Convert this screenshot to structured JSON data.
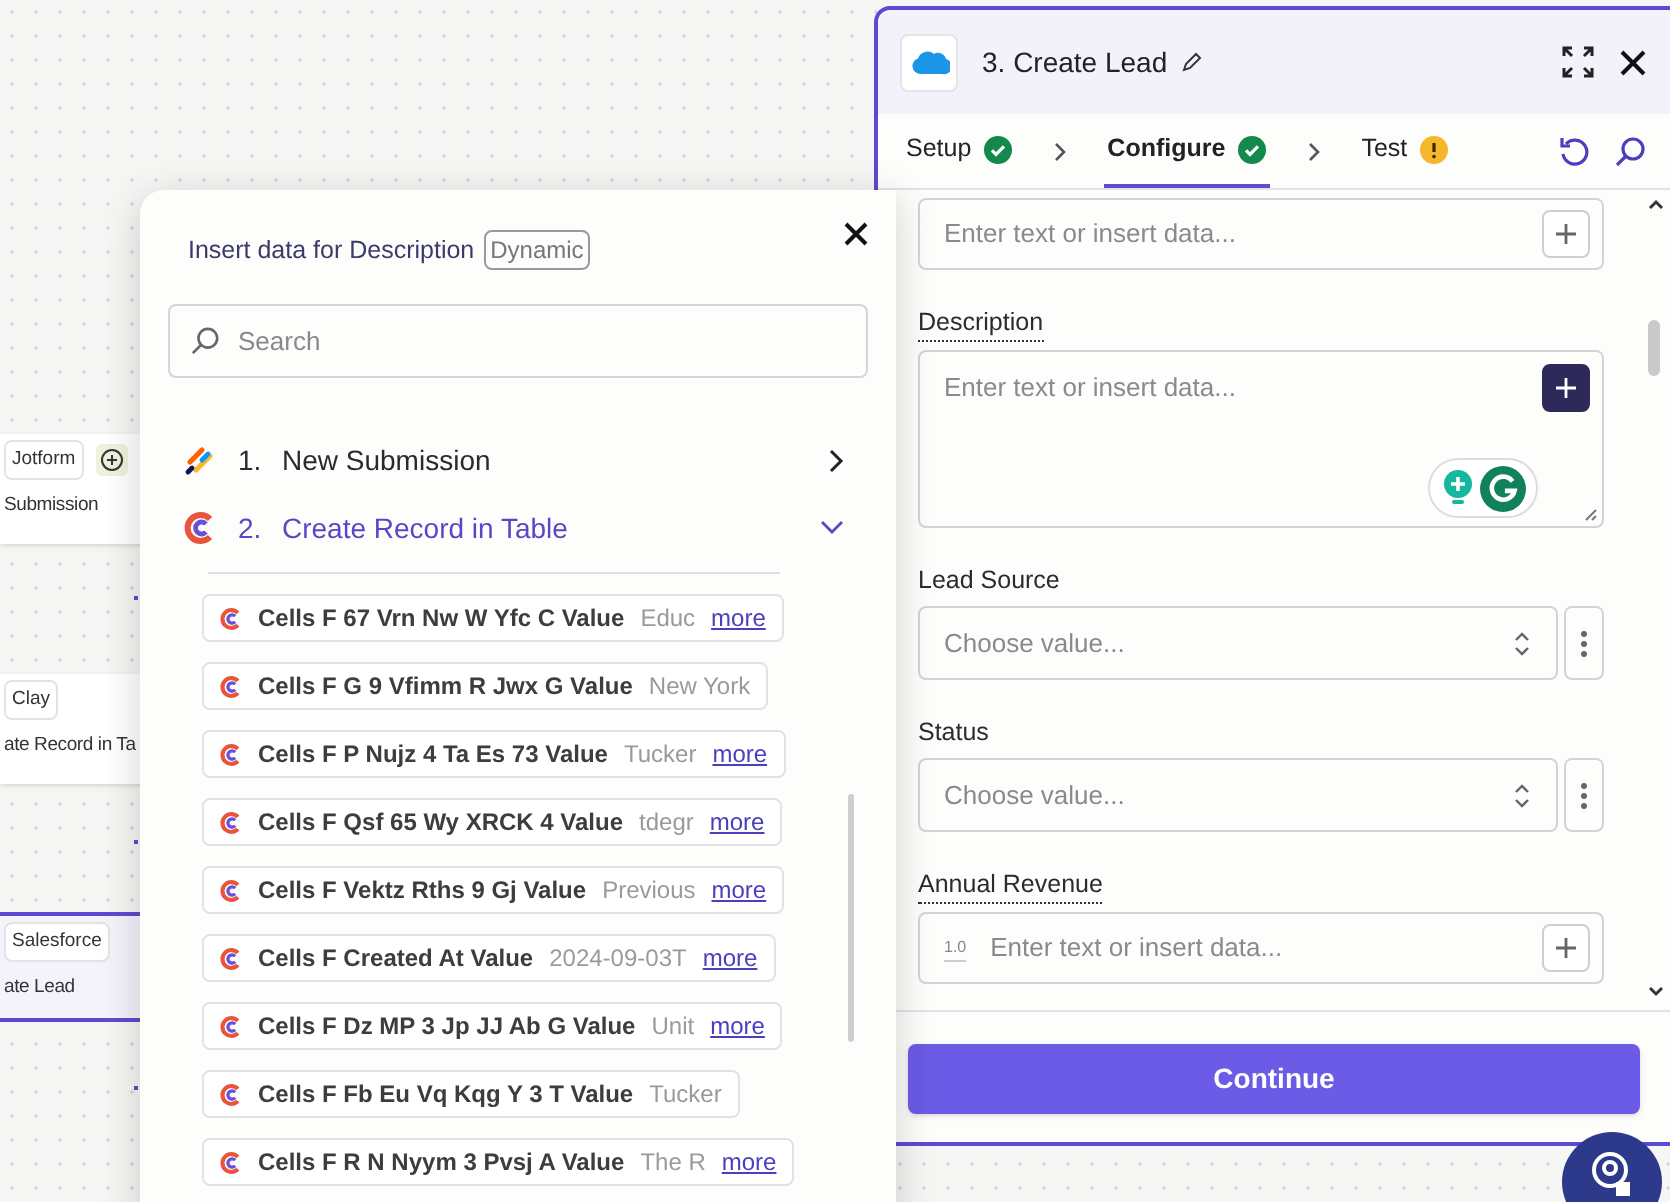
{
  "canvas": {
    "nodes": [
      {
        "app": "Jotform",
        "title": "Submission",
        "selected": false,
        "add_button": true
      },
      {
        "app": "Clay",
        "title": "ate Record in Ta",
        "selected": false,
        "add_button": false
      },
      {
        "app": "Salesforce",
        "title": "ate Lead",
        "selected": true,
        "add_button": false
      }
    ]
  },
  "panel": {
    "title": "3. Create Lead",
    "tabs": [
      {
        "label": "Setup",
        "kind": "done",
        "selected": false
      },
      {
        "label": "Configure",
        "kind": "done",
        "selected": true
      },
      {
        "label": "Test",
        "kind": "warning",
        "selected": false
      }
    ],
    "fields": [
      {
        "kind": "text",
        "placeholder": "Enter text or insert data...",
        "focused": false
      },
      {
        "kind": "textarea",
        "label": "Description",
        "tooltip": true,
        "placeholder": "Enter text or insert data...",
        "focused": true
      },
      {
        "kind": "select",
        "label": "Lead Source",
        "tooltip": false,
        "placeholder": "Choose value...",
        "focused": false
      },
      {
        "kind": "select",
        "label": "Status",
        "tooltip": false,
        "placeholder": "Choose value...",
        "focused": false
      },
      {
        "kind": "number",
        "label": "Annual Revenue",
        "tooltip": true,
        "prefix": "1.0",
        "placeholder": "Enter text or insert data...",
        "focused": false
      }
    ],
    "continue_button": "Continue"
  },
  "popup": {
    "title": "Insert data for Description",
    "badge": "Dynamic",
    "search": {
      "placeholder": "Search"
    },
    "steps": [
      {
        "kind": "jotform",
        "number": "1.",
        "label": "New Submission",
        "expanded": false
      },
      {
        "kind": "clay",
        "number": "2.",
        "label": "Create Record in Table",
        "expanded": true,
        "items": [
          {
            "label": "Cells F 67 Vrn Nw W Yfc C Value",
            "value": "Educ",
            "more": "more"
          },
          {
            "label": "Cells F G 9 Vfimm R Jwx G Value",
            "value": "New York"
          },
          {
            "label": "Cells F P Nujz 4 Ta Es 73 Value",
            "value": "Tucker",
            "more": "more"
          },
          {
            "label": "Cells F Qsf 65 Wy XRCK 4 Value",
            "value": "tdegr",
            "more": "more"
          },
          {
            "label": "Cells F Vektz Rths 9 Gj Value",
            "value": "Previous",
            "more": "more"
          },
          {
            "label": "Cells F Created At Value",
            "value": "2024-09-03T",
            "more": "more"
          },
          {
            "label": "Cells F Dz MP 3 Jp JJ Ab G Value",
            "value": "Unit",
            "more": "more"
          },
          {
            "label": "Cells F Fb Eu Vq Kqg Y 3 T Value",
            "value": "Tucker"
          },
          {
            "label": "Cells F R N Nyym 3 Pvsj A Value",
            "value": "The R",
            "more": "more"
          }
        ]
      }
    ]
  }
}
